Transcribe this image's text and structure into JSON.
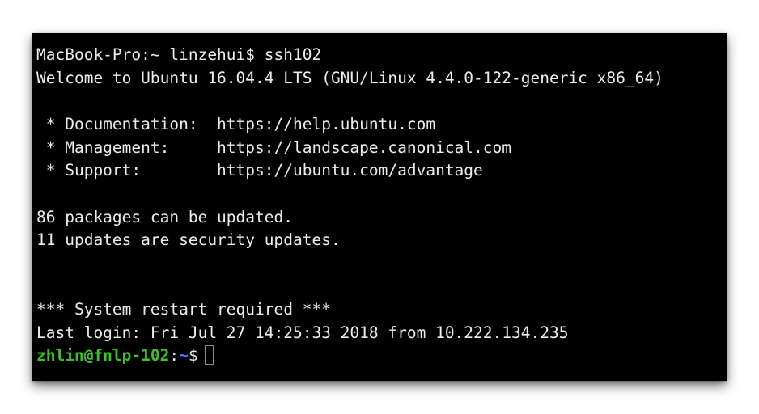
{
  "terminal": {
    "lines": {
      "l1": "MacBook-Pro:~ linzehui$ ssh102",
      "l2": "Welcome to Ubuntu 16.04.4 LTS (GNU/Linux 4.4.0-122-generic x86_64)",
      "l4": " * Documentation:  https://help.ubuntu.com",
      "l5": " * Management:     https://landscape.canonical.com",
      "l6": " * Support:        https://ubuntu.com/advantage",
      "l8": "86 packages can be updated.",
      "l9": "11 updates are security updates.",
      "l12": "*** System restart required ***",
      "l13": "Last login: Fri Jul 27 14:25:33 2018 from 10.222.134.235"
    },
    "prompt": {
      "user_host": "zhlin@fnlp-102",
      "separator": ":",
      "path": "~",
      "symbol": "$"
    }
  },
  "colors": {
    "background": "#000000",
    "text": "#ececec",
    "prompt_user": "#3fbf2e",
    "prompt_path": "#5b74ff"
  }
}
